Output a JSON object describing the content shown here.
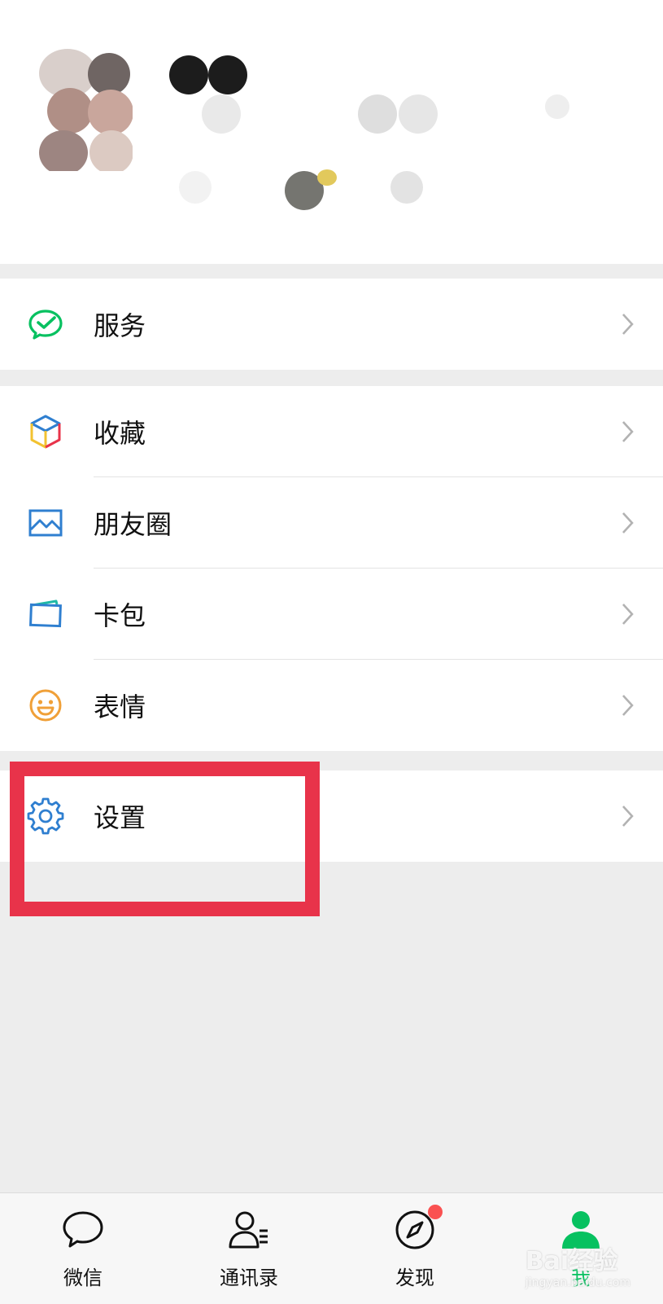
{
  "menu": {
    "service": {
      "label": "服务",
      "icon": "wechat-pay-icon"
    },
    "favorites": {
      "label": "收藏",
      "icon": "cube-icon"
    },
    "moments": {
      "label": "朋友圈",
      "icon": "photo-icon"
    },
    "cards": {
      "label": "卡包",
      "icon": "card-wallet-icon"
    },
    "stickers": {
      "label": "表情",
      "icon": "smile-icon"
    },
    "settings": {
      "label": "设置",
      "icon": "gear-icon"
    }
  },
  "tabbar": {
    "tabs": [
      {
        "label": "微信",
        "icon": "chat-bubble-icon"
      },
      {
        "label": "通讯录",
        "icon": "contacts-icon"
      },
      {
        "label": "发现",
        "icon": "compass-icon"
      },
      {
        "label": "我",
        "icon": "person-icon"
      }
    ],
    "active_index": 3
  },
  "watermark": {
    "brand": "Bai经验",
    "url": "jingyan.baidu.com"
  },
  "colors": {
    "accent_green": "#07c160",
    "highlight_red": "#e8334a",
    "badge_red": "#fa5151",
    "icon_blue": "#2f7fd0"
  }
}
